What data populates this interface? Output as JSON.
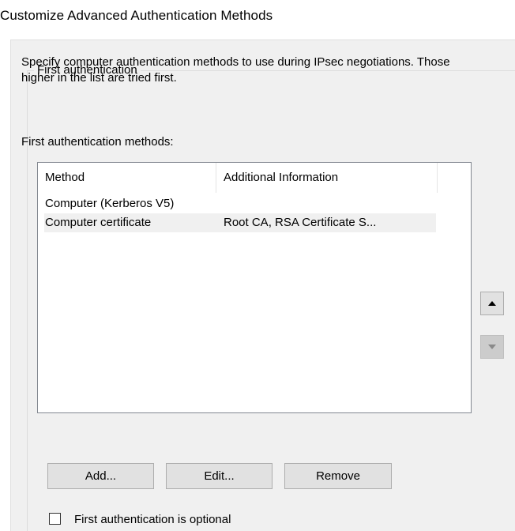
{
  "window": {
    "title": "Customize Advanced Authentication Methods"
  },
  "first_authentication": {
    "group_label": "First authentication",
    "description": "Specify computer authentication methods to use during IPsec negotiations.  Those higher in the list are tried first.",
    "methods_label": "First authentication methods:",
    "list": {
      "columns": [
        "Method",
        "Additional Information"
      ],
      "rows": [
        {
          "method": "Computer (Kerberos V5)",
          "info": ""
        },
        {
          "method": "Computer certificate",
          "info": "Root CA, RSA Certificate S..."
        }
      ],
      "selected_row": 1
    },
    "move_up_icon": "triangle-up-icon",
    "move_down_icon": "triangle-down-icon",
    "buttons": {
      "add": "Add...",
      "edit": "Edit...",
      "remove": "Remove"
    },
    "optional_checkbox": {
      "label": "First authentication is optional",
      "checked": false
    }
  },
  "colors": {
    "dialog_background": "#f0f0f0",
    "button_face": "#e1e1e1",
    "button_border": "#adadad",
    "list_border": "#828790"
  }
}
